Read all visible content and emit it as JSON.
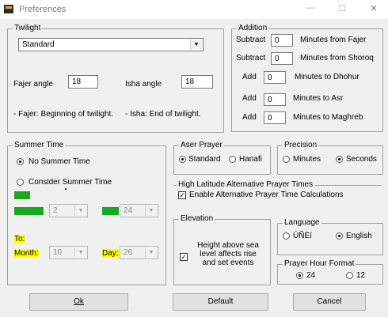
{
  "window": {
    "title": "Preferences",
    "minimize": "—",
    "maximize": "☐",
    "close": "✕"
  },
  "twilight": {
    "legend": "Twilight",
    "method": "Standard",
    "fajer_label": "Fajer angle",
    "fajer_value": "18",
    "isha_label": "Isha angle",
    "isha_value": "18",
    "fajer_note": "- Fajer: Beginning of twilight.",
    "isha_note": "- Isha: End of twilight."
  },
  "addition": {
    "legend": "Addition",
    "rows": [
      {
        "op": "Subtract",
        "value": "0",
        "desc": "Minutes from Fajer"
      },
      {
        "op": "Subtract",
        "value": "0",
        "desc": "Minutes from Shoroq"
      },
      {
        "op": "Add",
        "value": "0",
        "desc": "Minutes to Dhohur"
      },
      {
        "op": "Add",
        "value": "0",
        "desc": "Minutes to Asr"
      },
      {
        "op": "Add",
        "value": "0",
        "desc": "Minutes to Maghreb"
      }
    ]
  },
  "summer": {
    "legend": "Summer Time",
    "no_summer": "No Summer Time",
    "consider": "Consider Summer Time",
    "from_value1": "2",
    "from_value2": "24",
    "to_label": "To:",
    "month_label": "Month:",
    "month_value": "10",
    "day_label": "Day:",
    "day_value": "26"
  },
  "aser": {
    "legend": "Aser Prayer",
    "standard": "Standard",
    "hanafi": "Hanafi"
  },
  "precision": {
    "legend": "Precision",
    "minutes": "Minutes",
    "seconds": "Seconds"
  },
  "high_latitude": {
    "legend": "High Latitude Alternative Prayer Times",
    "enable": "Enable Alternative Prayer Time Calculations"
  },
  "elevation": {
    "legend": "Elevation",
    "text": "Height above sea level affects rise and set events"
  },
  "language": {
    "legend": "Language",
    "arabic": "ÚÑÈí",
    "english": "English"
  },
  "hour_format": {
    "legend": "Prayer Hour Format",
    "h24": "24",
    "h12": "12"
  },
  "buttons": {
    "ok": "Ok",
    "default": "Default",
    "cancel": "Cancel"
  },
  "colors": {
    "green": "#18a820",
    "highlight": "#ffff00"
  }
}
